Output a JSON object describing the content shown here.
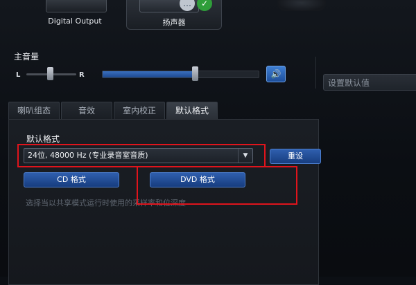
{
  "devices": [
    {
      "label": "Digital Output",
      "selected": false
    },
    {
      "label": "扬声器",
      "selected": true
    }
  ],
  "icons": {
    "mute": "speaker-icon",
    "chat": "chat-bubble-icon",
    "check": "checkmark-icon",
    "dropdown": "chevron-down-icon"
  },
  "master_volume": {
    "title": "主音量",
    "balance_left": "L",
    "balance_right": "R",
    "level_fraction": 0.58
  },
  "set_default": "设置默认值",
  "tabs": [
    {
      "label": "喇叭组态"
    },
    {
      "label": "音效"
    },
    {
      "label": "室内校正"
    },
    {
      "label": "默认格式",
      "active": true
    }
  ],
  "default_format": {
    "section_title": "默认格式",
    "selected_format": "24位, 48000 Hz (专业录音室音质)",
    "reset_label": "重设",
    "cd_format_label": "CD 格式",
    "dvd_format_label": "DVD 格式",
    "hint": "选择当以共享模式运行时使用的采样率和位深度"
  },
  "colors": {
    "accent_blue": "#2f5fae",
    "highlight_red": "#e0141c",
    "check_green": "#2f9e3a"
  }
}
